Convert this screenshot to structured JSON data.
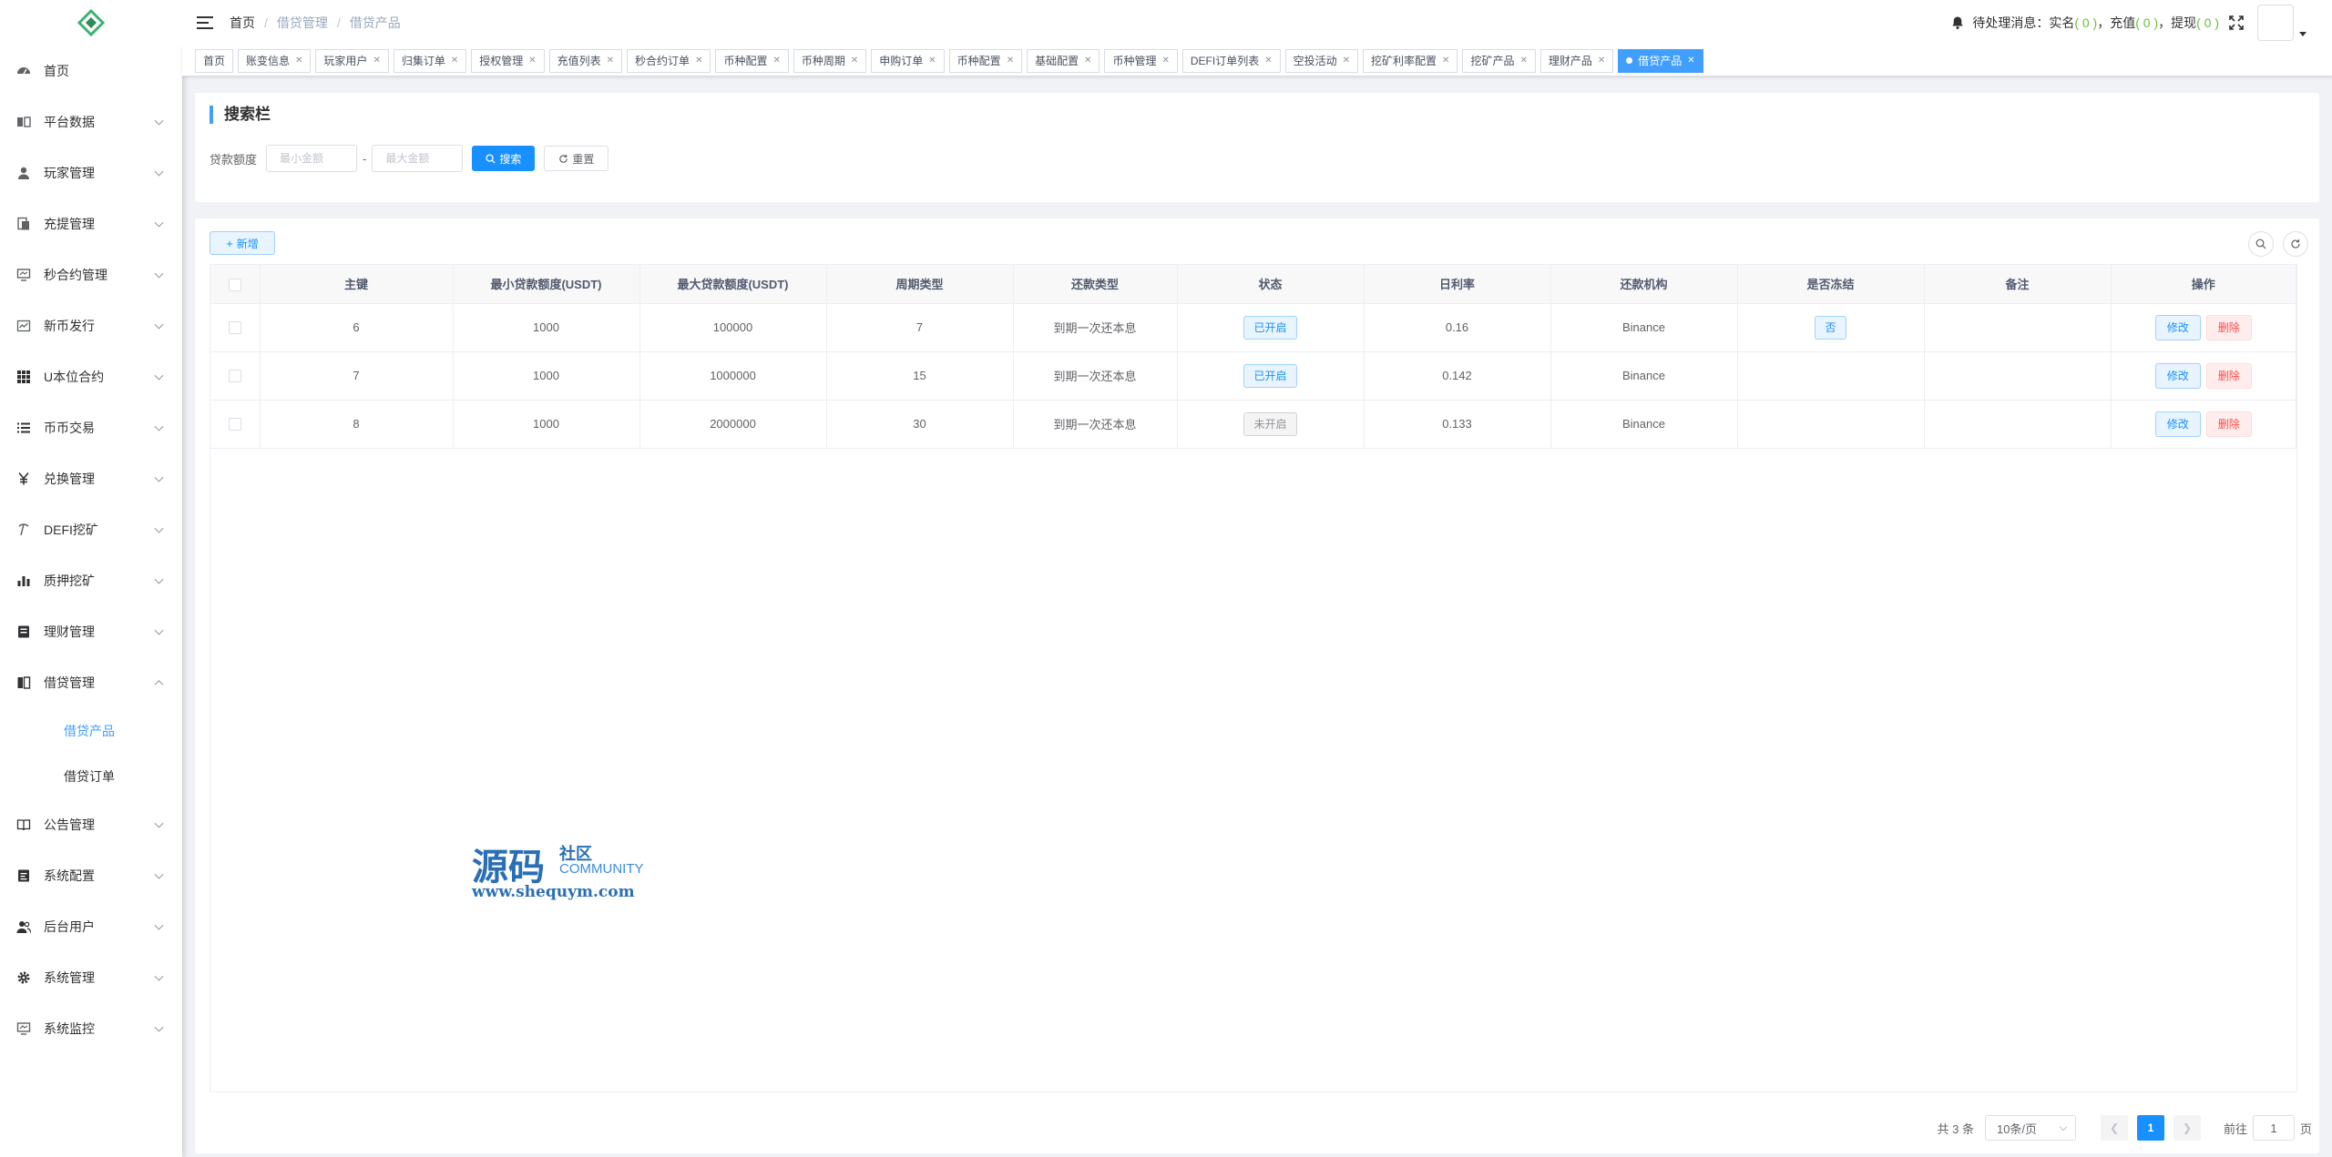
{
  "sidebar": {
    "items": [
      {
        "label": "首页",
        "icon": "dashboard-icon"
      },
      {
        "label": "平台数据",
        "icon": "data-icon"
      },
      {
        "label": "玩家管理",
        "icon": "user-icon"
      },
      {
        "label": "充提管理",
        "icon": "document-icon"
      },
      {
        "label": "秒合约管理",
        "icon": "monitor-icon"
      },
      {
        "label": "新币发行",
        "icon": "chart-icon"
      },
      {
        "label": "U本位合约",
        "icon": "grid-icon"
      },
      {
        "label": "币币交易",
        "icon": "list-icon"
      },
      {
        "label": "兑换管理",
        "icon": "yen-icon"
      },
      {
        "label": "DEFI挖矿",
        "icon": "pickaxe-icon"
      },
      {
        "label": "质押挖矿",
        "icon": "bar-chart-icon"
      },
      {
        "label": "理财管理",
        "icon": "notebook-icon"
      },
      {
        "label": "借贷管理",
        "icon": "book-icon"
      }
    ],
    "sub_items": [
      {
        "label": "借贷产品"
      },
      {
        "label": "借贷订单"
      }
    ],
    "items_after": [
      {
        "label": "公告管理",
        "icon": "open-book-icon"
      },
      {
        "label": "系统配置",
        "icon": "config-icon"
      },
      {
        "label": "后台用户",
        "icon": "users-icon"
      },
      {
        "label": "系统管理",
        "icon": "gear-icon"
      },
      {
        "label": "系统监控",
        "icon": "monitor-icon"
      }
    ]
  },
  "navbar": {
    "breadcrumb": [
      "首页",
      "借贷管理",
      "借贷产品"
    ],
    "notice_label": "待处理消息：",
    "notice_realname": "实名",
    "notice_recharge": "充值",
    "notice_withdraw": "提现",
    "count_realname": "( 0 )",
    "count_recharge": "( 0 )",
    "count_withdraw": "( 0 )",
    "comma": "，"
  },
  "tags": [
    "首页",
    "账变信息",
    "玩家用户",
    "归集订单",
    "授权管理",
    "充值列表",
    "秒合约订单",
    "币种配置",
    "币种周期",
    "申购订单",
    "币种配置",
    "基础配置",
    "币种管理",
    "DEFI订单列表",
    "空投活动",
    "挖矿利率配置",
    "挖矿产品",
    "理财产品",
    "借贷产品"
  ],
  "search": {
    "title": "搜索栏",
    "label": "贷款额度",
    "min_placeholder": "最小金额",
    "max_placeholder": "最大金额",
    "dash": "-",
    "search_btn": "搜索",
    "reset_btn": "重置"
  },
  "toolbar": {
    "add_btn": "新增"
  },
  "table": {
    "headers": [
      "主键",
      "最小贷款额度(USDT)",
      "最大贷款额度(USDT)",
      "周期类型",
      "还款类型",
      "状态",
      "日利率",
      "还款机构",
      "是否冻结",
      "备注",
      "操作"
    ],
    "rows": [
      {
        "id": "6",
        "min": "1000",
        "max": "100000",
        "cycle": "7",
        "repay": "到期一次还本息",
        "status": "已开启",
        "status_on": true,
        "rate": "0.16",
        "org": "Binance",
        "frozen": "否",
        "remark": ""
      },
      {
        "id": "7",
        "min": "1000",
        "max": "1000000",
        "cycle": "15",
        "repay": "到期一次还本息",
        "status": "已开启",
        "status_on": true,
        "rate": "0.142",
        "org": "Binance",
        "frozen": "",
        "remark": ""
      },
      {
        "id": "8",
        "min": "1000",
        "max": "2000000",
        "cycle": "30",
        "repay": "到期一次还本息",
        "status": "未开启",
        "status_on": false,
        "rate": "0.133",
        "org": "Binance",
        "frozen": "",
        "remark": ""
      }
    ],
    "edit_label": "修改",
    "delete_label": "删除"
  },
  "pagination": {
    "total_text": "共 3 条",
    "page_size": "10条/页",
    "current_page": "1",
    "goto_label": "前往",
    "goto_value": "1",
    "page_suffix": "页"
  },
  "watermark": {
    "big": "源码",
    "small1": "社区",
    "small2": "COMMUNITY",
    "url": "www.shequym.com"
  },
  "colors": {
    "primary": "#1890ff",
    "success": "#67c23a",
    "danger": "#ff4949"
  }
}
